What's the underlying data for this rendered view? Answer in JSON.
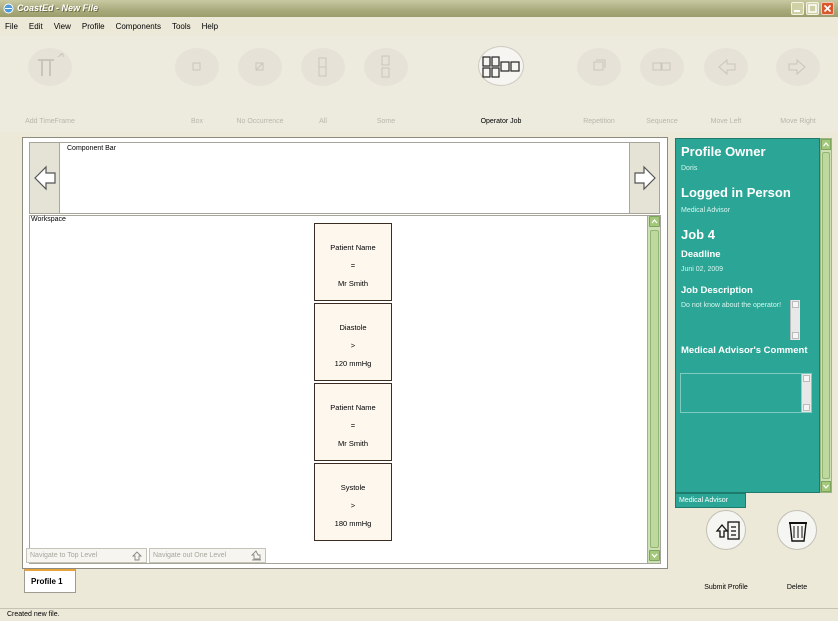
{
  "window": {
    "title": "CoastEd - New File"
  },
  "menu": {
    "items": [
      "File",
      "Edit",
      "View",
      "Profile",
      "Components",
      "Tools",
      "Help"
    ]
  },
  "toolbar": {
    "add_timeframe": "Add TimeFrame",
    "box": "Box",
    "no_occurrence": "No Occurrence",
    "all": "All",
    "some": "Some",
    "operator_job": "Operator Job",
    "repetition": "Repetition",
    "sequence": "Sequence",
    "move_left": "Move Left",
    "move_right": "Move Right"
  },
  "component_bar": {
    "label": "Component Bar"
  },
  "workspace": {
    "label": "Workspace",
    "cards": [
      {
        "line1": "Patient Name",
        "line2": "=",
        "line3": "Mr Smith"
      },
      {
        "line1": "Diastole",
        "line2": ">",
        "line3": "120 mmHg"
      },
      {
        "line1": "Patient Name",
        "line2": "=",
        "line3": "Mr Smith"
      },
      {
        "line1": "Systole",
        "line2": ">",
        "line3": "180 mmHg"
      }
    ],
    "nav_top": "Navigate to Top Level",
    "nav_out": "Navigate out One Level"
  },
  "tabs": {
    "profile1": "Profile 1"
  },
  "side_panel": {
    "profile_owner_heading": "Profile Owner",
    "profile_owner_value": "Doris",
    "logged_in_heading": "Logged in Person",
    "logged_in_value": "Medical Advisor",
    "job_heading": "Job 4",
    "deadline_heading": "Deadline",
    "deadline_value": "Juni 02, 2009",
    "job_description_heading": "Job Description",
    "job_description_value": "Do not know about the operator!",
    "comment_heading": "Medical Advisor's Comment",
    "comment_value": "",
    "tab_label": "Medical Advisor"
  },
  "actions": {
    "submit_profile": "Submit Profile",
    "delete": "Delete"
  },
  "status": {
    "text": "Created new file."
  },
  "colors": {
    "panel_teal": "#2ba696",
    "scroll_green": "#a3c87c",
    "tab_accent": "#e8a23a"
  }
}
